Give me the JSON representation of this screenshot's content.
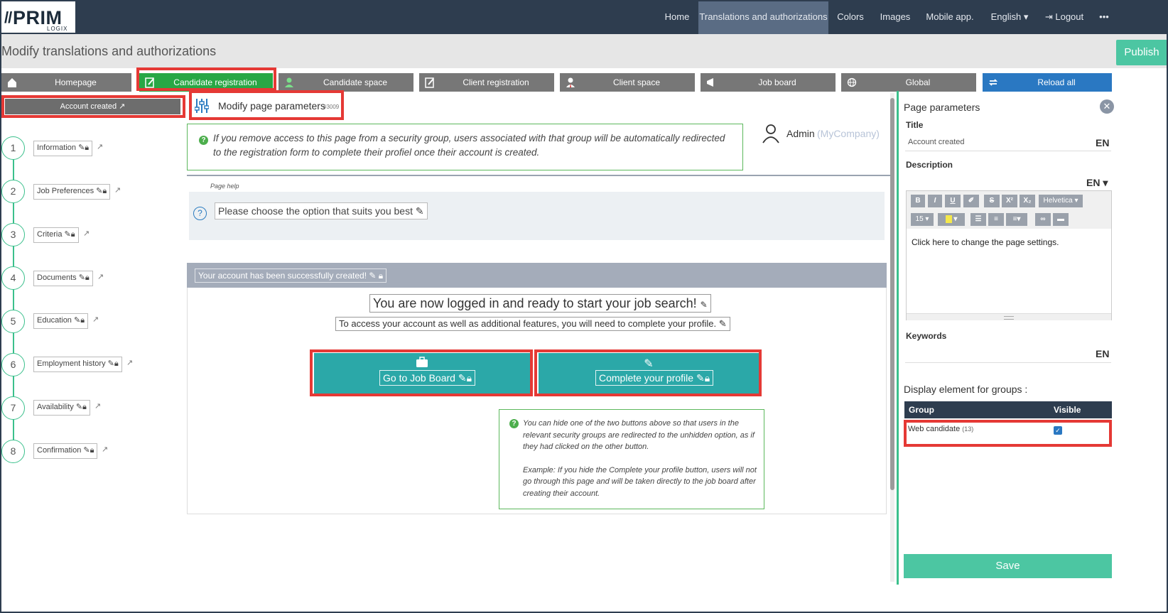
{
  "brand": {
    "logo_main": "PRIM",
    "logo_sub": "LOGIX"
  },
  "nav": {
    "items": [
      "Home",
      "Translations and authorizations",
      "Colors",
      "Images",
      "Mobile app.",
      "English ▾",
      "⇥ Logout",
      "•••"
    ],
    "active": "Translations and authorizations"
  },
  "page": {
    "title": "Modify translations and authorizations",
    "publish_label": "Publish"
  },
  "tabs": [
    {
      "label": "Homepage",
      "icon": "home-icon"
    },
    {
      "label": "Candidate registration",
      "icon": "edit-form-icon"
    },
    {
      "label": "Candidate space",
      "icon": "user-icon"
    },
    {
      "label": "Client registration",
      "icon": "edit-form-icon"
    },
    {
      "label": "Client space",
      "icon": "user-tie-icon"
    },
    {
      "label": "Job board",
      "icon": "megaphone-icon"
    },
    {
      "label": "Global",
      "icon": "globe-icon"
    },
    {
      "label": "Reload all",
      "icon": "refresh-icon"
    }
  ],
  "left": {
    "account_created": "Account created",
    "steps": [
      {
        "num": "1",
        "label": "Information"
      },
      {
        "num": "2",
        "label": "Job Preferences"
      },
      {
        "num": "3",
        "label": "Criteria"
      },
      {
        "num": "4",
        "label": "Documents"
      },
      {
        "num": "5",
        "label": "Education"
      },
      {
        "num": "6",
        "label": "Employment history"
      },
      {
        "num": "7",
        "label": "Availability"
      },
      {
        "num": "8",
        "label": "Confirmation"
      }
    ]
  },
  "center": {
    "modify_params_label": "Modify page parameters",
    "modify_params_id": "#3009",
    "access_note": "If you remove access to this page from a security group, users associated with that group will be automatically redirected to the registration form to complete their profiel once their account is created.",
    "admin_name": "Admin",
    "admin_company": "(MyCompany)",
    "page_help_label": "Page help",
    "page_help_text": "Please choose the option that suits you best",
    "success_text": "Your account has been successfully created!",
    "logged_in_text": "You are now logged in and ready to start your job search!",
    "access_text": "To access your account as well as additional features, you will need to complete your profile.",
    "btn_job_board": "Go to Job Board",
    "btn_complete_profile": "Complete your profile",
    "hide_note_1": "You can hide one of the two buttons above so that users in the relevant security groups are redirected to the unhidden option, as if they had clicked on the other button.",
    "hide_note_2": "Example: If you hide the Complete your profile button, users will not go through this page and will be taken directly to the job board after creating their account."
  },
  "right": {
    "title": "Page parameters",
    "title_label": "Title",
    "title_value": "Account created",
    "lang": "EN",
    "lang_dropdown": "EN ▾",
    "description_label": "Description",
    "toolbar": {
      "bold": "B",
      "italic": "I",
      "underline": "U",
      "eraser": "✐",
      "strike": "S",
      "sup": "X²",
      "sub": "X₂",
      "font": "Helvetica ▾",
      "size": "15 ▾"
    },
    "editor_text": "Click here to change the page settings.",
    "keywords_label": "Keywords",
    "display_groups_label": "Display element for groups :",
    "group_col": "Group",
    "visible_col": "Visible",
    "group_name": "Web candidate",
    "group_count": "(13)",
    "group_visible": true,
    "save_label": "Save"
  },
  "colors": {
    "nav_bg": "#2e3d4f",
    "accent_green": "#28a745",
    "teal": "#2ba8a8",
    "highlight_red": "#e53935",
    "publish": "#4cc6a2"
  }
}
